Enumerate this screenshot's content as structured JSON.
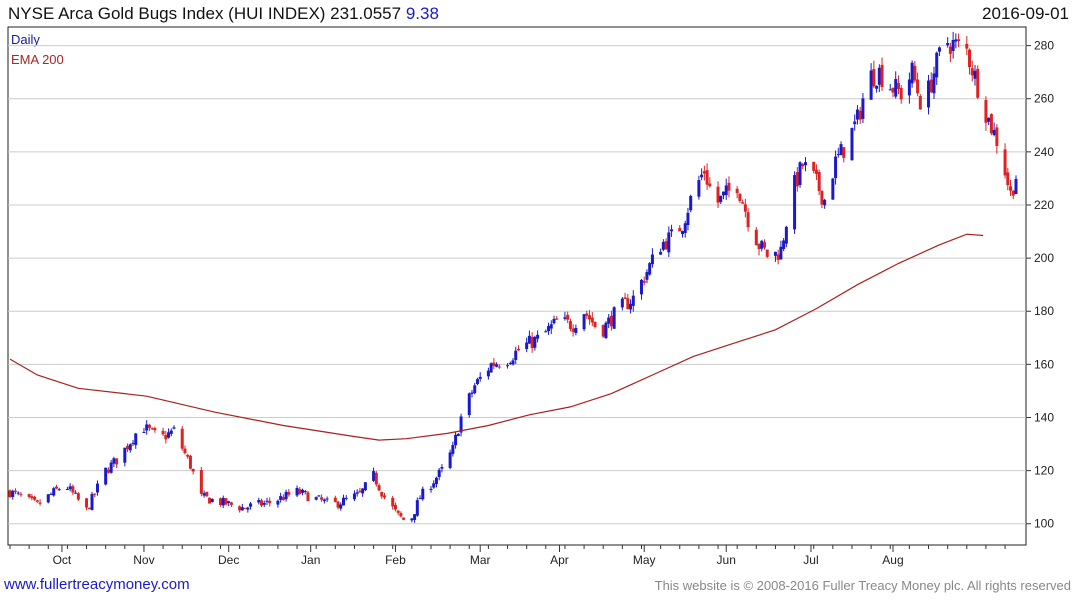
{
  "header": {
    "title": "NYSE Arca Gold Bugs Index (HUI INDEX) 231.0557",
    "change": "9.38",
    "date": "2016-09-01"
  },
  "legend": {
    "daily": "Daily",
    "ema": "EMA 200"
  },
  "footer": {
    "website": "www.fullertreacymoney.com",
    "copyright": "This website is © 2008-2016 Fuller Treacy Money plc. All rights reserved"
  },
  "colors": {
    "up": "#1a1acc",
    "down": "#dd2222",
    "ema": "#aa2020",
    "grid": "#cccccc",
    "axis": "#333333"
  },
  "chart_data": {
    "type": "candlestick",
    "title": "NYSE Arca Gold Bugs Index (HUI INDEX)",
    "last_value": 231.0557,
    "change": 9.38,
    "as_of": "2016-09-01",
    "period": "Daily",
    "ylim": [
      92,
      287
    ],
    "y_ticks": [
      100,
      120,
      140,
      160,
      180,
      200,
      220,
      240,
      260,
      280
    ],
    "x_ticks": [
      "Oct",
      "Nov",
      "Dec",
      "Jan",
      "Feb",
      "Mar",
      "Apr",
      "May",
      "Jun",
      "Jul",
      "Aug"
    ],
    "grid": true,
    "y_axis_side": "right",
    "series": [
      {
        "name": "Daily",
        "kind": "candlestick",
        "close_path": [
          [
            0,
            112
          ],
          [
            10,
            107
          ],
          [
            20,
            115
          ],
          [
            28,
            105
          ],
          [
            35,
            120
          ],
          [
            40,
            125
          ],
          [
            48,
            137
          ],
          [
            55,
            132
          ],
          [
            60,
            135
          ],
          [
            66,
            122
          ],
          [
            70,
            110
          ],
          [
            85,
            106
          ],
          [
            95,
            108
          ],
          [
            105,
            112
          ],
          [
            118,
            107
          ],
          [
            128,
            111
          ],
          [
            133,
            118
          ],
          [
            137,
            110
          ],
          [
            142,
            103
          ],
          [
            146,
            100
          ],
          [
            150,
            110
          ],
          [
            154,
            115
          ],
          [
            158,
            120
          ],
          [
            162,
            128
          ],
          [
            165,
            140
          ],
          [
            170,
            152
          ],
          [
            176,
            160
          ],
          [
            182,
            162
          ],
          [
            188,
            167
          ],
          [
            194,
            170
          ],
          [
            200,
            176
          ],
          [
            206,
            175
          ],
          [
            210,
            180
          ],
          [
            216,
            172
          ],
          [
            222,
            180
          ],
          [
            228,
            185
          ],
          [
            234,
            197
          ],
          [
            238,
            205
          ],
          [
            242,
            208
          ],
          [
            246,
            213
          ],
          [
            250,
            225
          ],
          [
            254,
            233
          ],
          [
            258,
            220
          ],
          [
            262,
            224
          ],
          [
            266,
            228
          ],
          [
            270,
            215
          ],
          [
            274,
            205
          ],
          [
            278,
            200
          ],
          [
            282,
            203
          ],
          [
            286,
            225
          ],
          [
            290,
            235
          ],
          [
            294,
            230
          ],
          [
            298,
            222
          ],
          [
            302,
            236
          ],
          [
            306,
            243
          ],
          [
            310,
            252
          ],
          [
            314,
            268
          ],
          [
            318,
            270
          ],
          [
            322,
            265
          ],
          [
            326,
            262
          ],
          [
            330,
            270
          ],
          [
            334,
            256
          ],
          [
            338,
            270
          ],
          [
            342,
            282
          ],
          [
            346,
            280
          ],
          [
            350,
            278
          ],
          [
            354,
            265
          ],
          [
            358,
            252
          ],
          [
            362,
            242
          ],
          [
            366,
            224
          ],
          [
            368,
            231
          ]
        ]
      },
      {
        "name": "EMA 200",
        "kind": "line",
        "path": [
          [
            0,
            162
          ],
          [
            10,
            156
          ],
          [
            25,
            151
          ],
          [
            50,
            148
          ],
          [
            75,
            142
          ],
          [
            100,
            137
          ],
          [
            125,
            133
          ],
          [
            135,
            131.5
          ],
          [
            145,
            132
          ],
          [
            160,
            134
          ],
          [
            175,
            137
          ],
          [
            190,
            141
          ],
          [
            205,
            144
          ],
          [
            220,
            149
          ],
          [
            235,
            156
          ],
          [
            250,
            163
          ],
          [
            265,
            168
          ],
          [
            280,
            173
          ],
          [
            295,
            181
          ],
          [
            310,
            190
          ],
          [
            325,
            198
          ],
          [
            340,
            205
          ],
          [
            350,
            209
          ],
          [
            356,
            208.5
          ]
        ]
      }
    ]
  }
}
